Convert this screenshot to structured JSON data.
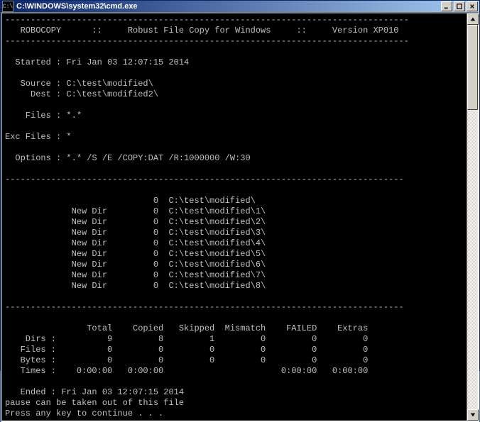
{
  "window": {
    "title": "C:\\WINDOWS\\system32\\cmd.exe",
    "icon_text": "C:\\"
  },
  "console": {
    "divider": "-------------------------------------------------------------------------------",
    "header": {
      "app": "ROBOCOPY",
      "sep": "::",
      "desc": "Robust File Copy for Windows",
      "version": "Version XP010"
    },
    "meta": {
      "started_label": "Started :",
      "started_value": "Fri Jan 03 12:07:15 2014",
      "source_label": "Source :",
      "source_value": "C:\\test\\modified\\",
      "dest_label": "Dest :",
      "dest_value": "C:\\test\\modified2\\",
      "files_label": "Files :",
      "files_value": "*.*",
      "exc_label": "Exc Files :",
      "exc_value": "*",
      "options_label": "Options :",
      "options_value": "*.* /S /E /COPY:DAT /R:1000000 /W:30"
    },
    "dirs": [
      {
        "tag": "",
        "count": "0",
        "path": "C:\\test\\modified\\"
      },
      {
        "tag": "New Dir",
        "count": "0",
        "path": "C:\\test\\modified\\1\\"
      },
      {
        "tag": "New Dir",
        "count": "0",
        "path": "C:\\test\\modified\\2\\"
      },
      {
        "tag": "New Dir",
        "count": "0",
        "path": "C:\\test\\modified\\3\\"
      },
      {
        "tag": "New Dir",
        "count": "0",
        "path": "C:\\test\\modified\\4\\"
      },
      {
        "tag": "New Dir",
        "count": "0",
        "path": "C:\\test\\modified\\5\\"
      },
      {
        "tag": "New Dir",
        "count": "0",
        "path": "C:\\test\\modified\\6\\"
      },
      {
        "tag": "New Dir",
        "count": "0",
        "path": "C:\\test\\modified\\7\\"
      },
      {
        "tag": "New Dir",
        "count": "0",
        "path": "C:\\test\\modified\\8\\"
      }
    ],
    "summary": {
      "headers": [
        "Total",
        "Copied",
        "Skipped",
        "Mismatch",
        "FAILED",
        "Extras"
      ],
      "rows": [
        {
          "label": "Dirs :",
          "vals": [
            "9",
            "8",
            "1",
            "0",
            "0",
            "0"
          ]
        },
        {
          "label": "Files :",
          "vals": [
            "0",
            "0",
            "0",
            "0",
            "0",
            "0"
          ]
        },
        {
          "label": "Bytes :",
          "vals": [
            "0",
            "0",
            "0",
            "0",
            "0",
            "0"
          ]
        },
        {
          "label": "Times :",
          "vals": [
            "0:00:00",
            "0:00:00",
            "",
            "",
            "0:00:00",
            "0:00:00"
          ]
        }
      ]
    },
    "footer": {
      "ended_label": "Ended :",
      "ended_value": "Fri Jan 03 12:07:15 2014",
      "pause_note": "pause can be taken out of this file",
      "prompt": "Press any key to continue . . ."
    }
  }
}
